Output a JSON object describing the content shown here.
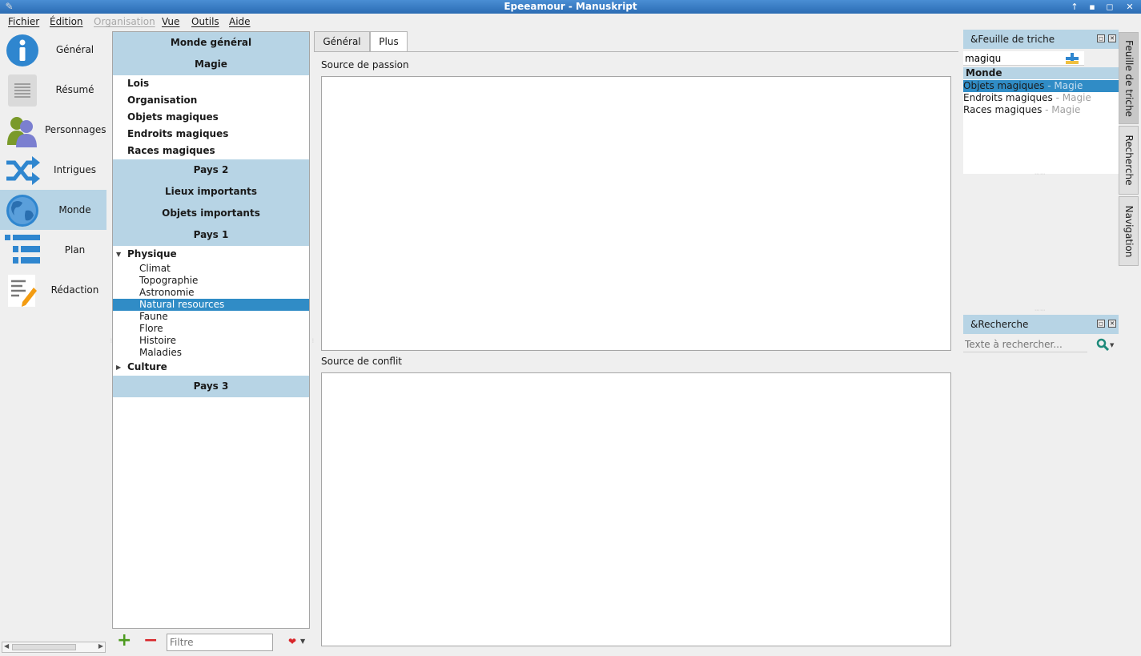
{
  "window": {
    "title": "Epeeamour - Manuskript",
    "controls": [
      "↑",
      "▪",
      "◻",
      "✕"
    ]
  },
  "menubar": {
    "items": [
      "Fichier",
      "Édition",
      "Organisation",
      "Vue",
      "Outils",
      "Aide"
    ]
  },
  "sidebar": {
    "items": [
      {
        "label": "Général"
      },
      {
        "label": "Résumé"
      },
      {
        "label": "Personnages"
      },
      {
        "label": "Intrigues"
      },
      {
        "label": "Monde"
      },
      {
        "label": "Plan"
      },
      {
        "label": "Rédaction"
      }
    ],
    "active": "Monde"
  },
  "world_tree": {
    "top_headers": [
      "Monde général",
      "Magie"
    ],
    "magie_children": [
      "Lois",
      "Organisation",
      "Objets magiques",
      "Endroits magiques",
      "Races magiques"
    ],
    "mid_headers": [
      "Pays 2",
      "Lieux importants",
      "Objets importants",
      "Pays 1"
    ],
    "physique_label": "Physique",
    "physique_children": [
      "Climat",
      "Topographie",
      "Astronomie",
      "Natural resources",
      "Faune",
      "Flore",
      "Histoire",
      "Maladies"
    ],
    "selected": "Natural resources",
    "culture_label": "Culture",
    "last_header": "Pays 3",
    "filter_placeholder": "Filtre",
    "add_symbol": "+",
    "remove_symbol": "−"
  },
  "editor": {
    "tabs": [
      "Général",
      "Plus"
    ],
    "active_tab": "Plus",
    "field1_label": "Source de passion",
    "field2_label": "Source de conflit"
  },
  "cheat_sheet": {
    "title": "&Feuille de triche",
    "input_value": "magiqu",
    "group_header": "Monde",
    "results": [
      {
        "name": "Objets magiques",
        "category": " - Magie",
        "selected": true
      },
      {
        "name": "Endroits magiques",
        "category": " - Magie",
        "selected": false
      },
      {
        "name": "Races magiques",
        "category": " - Magie",
        "selected": false
      }
    ]
  },
  "search_dock": {
    "title": "&Recherche",
    "placeholder": "Texte à rechercher..."
  },
  "right_vtabs": [
    "Feuille de triche",
    "Recherche",
    "Navigation"
  ],
  "colors": {
    "accent": "#308cc6",
    "header_bg": "#b7d4e5",
    "title_bar": "#2b6cb3"
  }
}
